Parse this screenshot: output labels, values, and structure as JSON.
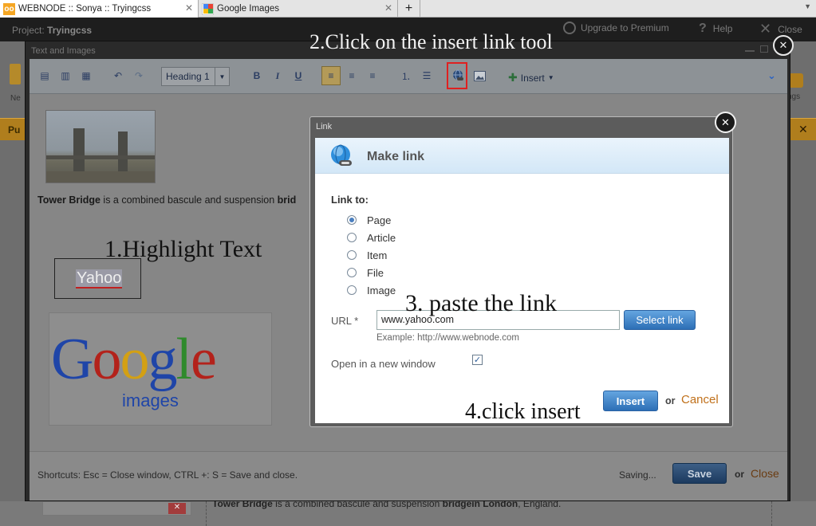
{
  "browser": {
    "tabs": [
      {
        "label": "WEBNODE :: Sonya :: Tryingcss",
        "active": true
      },
      {
        "label": "Google Images",
        "active": false
      }
    ],
    "new_tab": "+"
  },
  "app": {
    "project_prefix": "Project:",
    "project_name": "Tryingcss",
    "upgrade": "Upgrade to Premium",
    "help": "Help",
    "close": "Close",
    "left_tool": "Ne",
    "right_tool": "ngs",
    "orange_left": "Pu"
  },
  "editor": {
    "title": "Text and Images",
    "toolbar": {
      "heading_value": "Heading 1",
      "bold": "B",
      "italic": "I",
      "underline": "U",
      "insert": "Insert"
    },
    "content": {
      "caption_bold": "Tower Bridge",
      "caption_text": " is a combined bascule and suspension ",
      "caption_tail": "brid",
      "selected_link_text": "Yahoo",
      "google_logo": "Google",
      "google_sub": "images",
      "bottom_bold": "Tower Bridge",
      "bottom_text": " is a combined bascule and suspension ",
      "bottom_bold2": "bridgein London",
      "bottom_tail": ", England."
    },
    "footer": {
      "shortcuts": "Shortcuts: Esc = Close window, CTRL +: S = Save and close.",
      "saving": "Saving...",
      "save": "Save",
      "or": "or",
      "close": "Close"
    }
  },
  "dialog": {
    "window_title": "Link",
    "heading": "Make link",
    "link_to_label": "Link to:",
    "options": [
      "Page",
      "Article",
      "Item",
      "File",
      "Image"
    ],
    "selected_option": "Page",
    "url_label": "URL *",
    "url_value": "www.yahoo.com",
    "select_link": "Select link",
    "example": "Example: http://www.webnode.com",
    "new_window_label": "Open in a new window",
    "new_window_checked": true,
    "insert": "Insert",
    "or": "or",
    "cancel": "Cancel"
  },
  "annotations": {
    "step1": "1.Highlight Text",
    "step2": "2.Click on the insert link tool",
    "step3": "3. paste the link",
    "step4": "4.click insert"
  },
  "colors": {
    "accent_blue": "#2d6fb6",
    "cancel_orange": "#c0701a",
    "highlight_red": "#e02020"
  }
}
